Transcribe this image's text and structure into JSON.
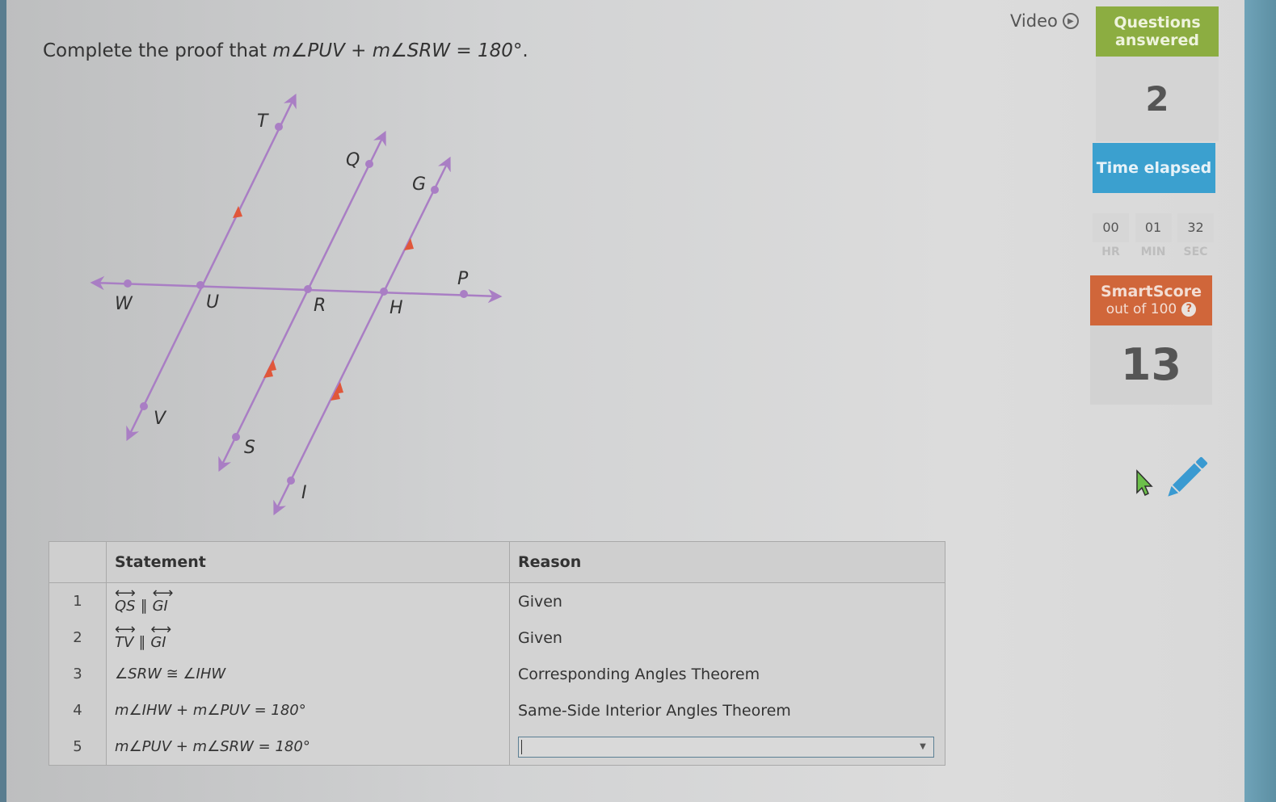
{
  "question": {
    "prefix": "Complete the proof that ",
    "math": "m∠PUV + m∠SRW = 180°",
    "suffix": "."
  },
  "diagram": {
    "points": [
      "T",
      "Q",
      "G",
      "W",
      "U",
      "R",
      "H",
      "P",
      "V",
      "S",
      "I"
    ],
    "parallel_marks": {
      "TV_GI": "single arrow",
      "QS_GI": "double arrow"
    }
  },
  "sidebar": {
    "video_label": "Video",
    "questions_answered_label": "Questions answered",
    "questions_answered_value": "2",
    "time_elapsed_label": "Time elapsed",
    "timer": [
      {
        "value": "00",
        "unit": "HR"
      },
      {
        "value": "01",
        "unit": "MIN"
      },
      {
        "value": "32",
        "unit": "SEC"
      }
    ],
    "smartscore_label": "SmartScore",
    "smartscore_sub": "out of 100",
    "smartscore_help": "?",
    "smartscore_value": "13",
    "colors": {
      "questions": "#8cad41",
      "time": "#3ba0cf",
      "smartscore": "#d0663a"
    }
  },
  "table": {
    "headers": {
      "statement": "Statement",
      "reason": "Reason"
    },
    "rows": [
      {
        "num": "1",
        "left": "QS",
        "right": "GI",
        "reason": "Given"
      },
      {
        "num": "2",
        "left": "TV",
        "right": "GI",
        "reason": "Given"
      },
      {
        "num": "3",
        "statement": "∠SRW ≅ ∠IHW",
        "reason": "Corresponding Angles Theorem"
      },
      {
        "num": "4",
        "statement": "m∠IHW + m∠PUV = 180°",
        "reason": "Same-Side Interior Angles Theorem"
      },
      {
        "num": "5",
        "statement": "m∠PUV + m∠SRW = 180°",
        "reason": ""
      }
    ],
    "parallel_symbol": "∥",
    "dropdown_caret": "▼"
  }
}
